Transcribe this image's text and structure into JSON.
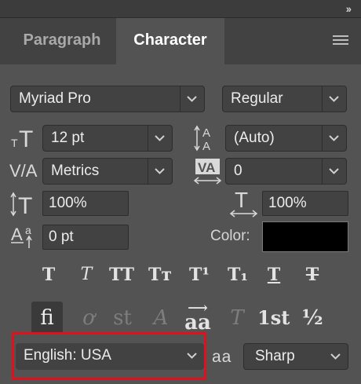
{
  "panel": {
    "collapse_glyph": "››",
    "tabs": [
      {
        "label": "Paragraph",
        "active": false
      },
      {
        "label": "Character",
        "active": true
      }
    ]
  },
  "font": {
    "family": "Myriad Pro",
    "style": "Regular"
  },
  "size": {
    "value": "12 pt"
  },
  "leading": {
    "value": "(Auto)"
  },
  "kerning": {
    "value": "Metrics"
  },
  "tracking": {
    "value": "0"
  },
  "vertical_scale": {
    "value": "100%"
  },
  "horizontal_scale": {
    "value": "100%"
  },
  "baseline_shift": {
    "value": "0 pt"
  },
  "color": {
    "label": "Color:",
    "value": "#000000"
  },
  "type_styles": [
    {
      "name": "faux-bold",
      "glyph": "T"
    },
    {
      "name": "faux-italic",
      "glyph": "T"
    },
    {
      "name": "all-caps",
      "glyph": "TT"
    },
    {
      "name": "small-caps",
      "glyph": "Tᴛ"
    },
    {
      "name": "superscript",
      "glyph": "T¹"
    },
    {
      "name": "subscript",
      "glyph": "T₁"
    },
    {
      "name": "underline",
      "glyph": "T"
    },
    {
      "name": "strikethrough",
      "glyph": "T"
    }
  ],
  "opentype": [
    {
      "name": "standard-ligatures",
      "glyph": "fi"
    },
    {
      "name": "contextual-alternates",
      "glyph": "ơ"
    },
    {
      "name": "discretionary-ligatures",
      "glyph": "st"
    },
    {
      "name": "swash",
      "glyph": "A"
    },
    {
      "name": "stylistic-alternates",
      "glyph": "aa"
    },
    {
      "name": "titling-alternates",
      "glyph": "T"
    },
    {
      "name": "ordinals",
      "glyph": "1st"
    },
    {
      "name": "fractions",
      "glyph": "½"
    }
  ],
  "language": {
    "value": "English: USA"
  },
  "antialias": {
    "icon_text": "aa",
    "value": "Sharp"
  },
  "colors": {
    "highlight": "#e0111c",
    "panel_bg": "#535353",
    "field_bg": "#424242"
  }
}
